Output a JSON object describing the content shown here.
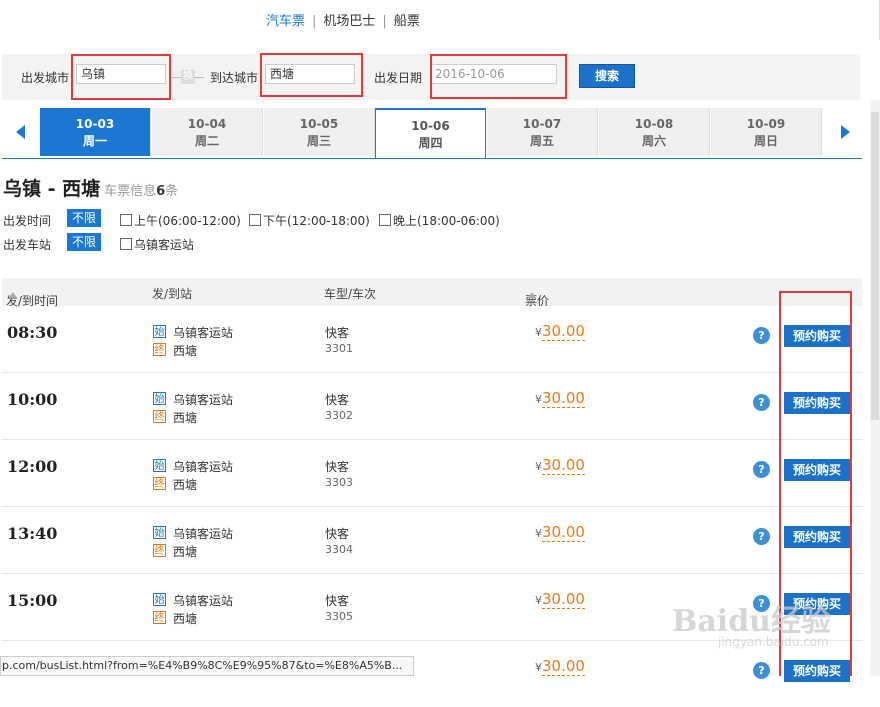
{
  "topnav": {
    "items": [
      "汽车票",
      "机场巴士",
      "船票"
    ]
  },
  "search": {
    "from_label": "出发城市",
    "from_value": "乌镇",
    "swap_label": "换",
    "to_label": "到达城市",
    "to_value": "西塘",
    "date_label": "出发日期",
    "date_value": "2016-10-06",
    "button": "搜索"
  },
  "dates": [
    {
      "date": "10-03",
      "weekday": "周一"
    },
    {
      "date": "10-04",
      "weekday": "周二"
    },
    {
      "date": "10-05",
      "weekday": "周三"
    },
    {
      "date": "10-06",
      "weekday": "周四"
    },
    {
      "date": "10-07",
      "weekday": "周五"
    },
    {
      "date": "10-08",
      "weekday": "周六"
    },
    {
      "date": "10-09",
      "weekday": "周日"
    }
  ],
  "heading": {
    "route": "乌镇 - 西塘",
    "info_prefix": "车票信息",
    "count": "6",
    "info_suffix": "条"
  },
  "filters": {
    "time_label": "出发时间",
    "unlimited": "不限",
    "time_options": [
      "上午(06:00-12:00)",
      "下午(12:00-18:00)",
      "晚上(18:00-06:00)"
    ],
    "station_label": "出发车站",
    "station_options": [
      "乌镇客运站"
    ]
  },
  "table": {
    "headers": [
      "发/到时间",
      "发/到站",
      "车型/车次",
      "票价"
    ],
    "start_tag": "始",
    "end_tag": "终",
    "currency": "¥",
    "help": "?",
    "buy": "预约购买",
    "rows": [
      {
        "time": "08:30",
        "from": "乌镇客运站",
        "to": "西塘",
        "type": "快客",
        "num": "3301",
        "price": "30.00"
      },
      {
        "time": "10:00",
        "from": "乌镇客运站",
        "to": "西塘",
        "type": "快客",
        "num": "3302",
        "price": "30.00"
      },
      {
        "time": "12:00",
        "from": "乌镇客运站",
        "to": "西塘",
        "type": "快客",
        "num": "3303",
        "price": "30.00"
      },
      {
        "time": "13:40",
        "from": "乌镇客运站",
        "to": "西塘",
        "type": "快客",
        "num": "3304",
        "price": "30.00"
      },
      {
        "time": "15:00",
        "from": "乌镇客运站",
        "to": "西塘",
        "type": "快客",
        "num": "3305",
        "price": "30.00"
      },
      {
        "time": "",
        "from": "",
        "to": "",
        "type": "",
        "num": "",
        "price": "30.00"
      }
    ]
  },
  "status_url": "p.com/busList.html?from=%E4%B9%8C%E9%95%87&to=%E8%A5%B...",
  "watermark": {
    "logo": "Baidu经验",
    "url": "jingyan.baidu.com"
  },
  "colors": {
    "accent": "#1a78d2",
    "price": "#f07a12",
    "highlight": "#e03a3a"
  }
}
